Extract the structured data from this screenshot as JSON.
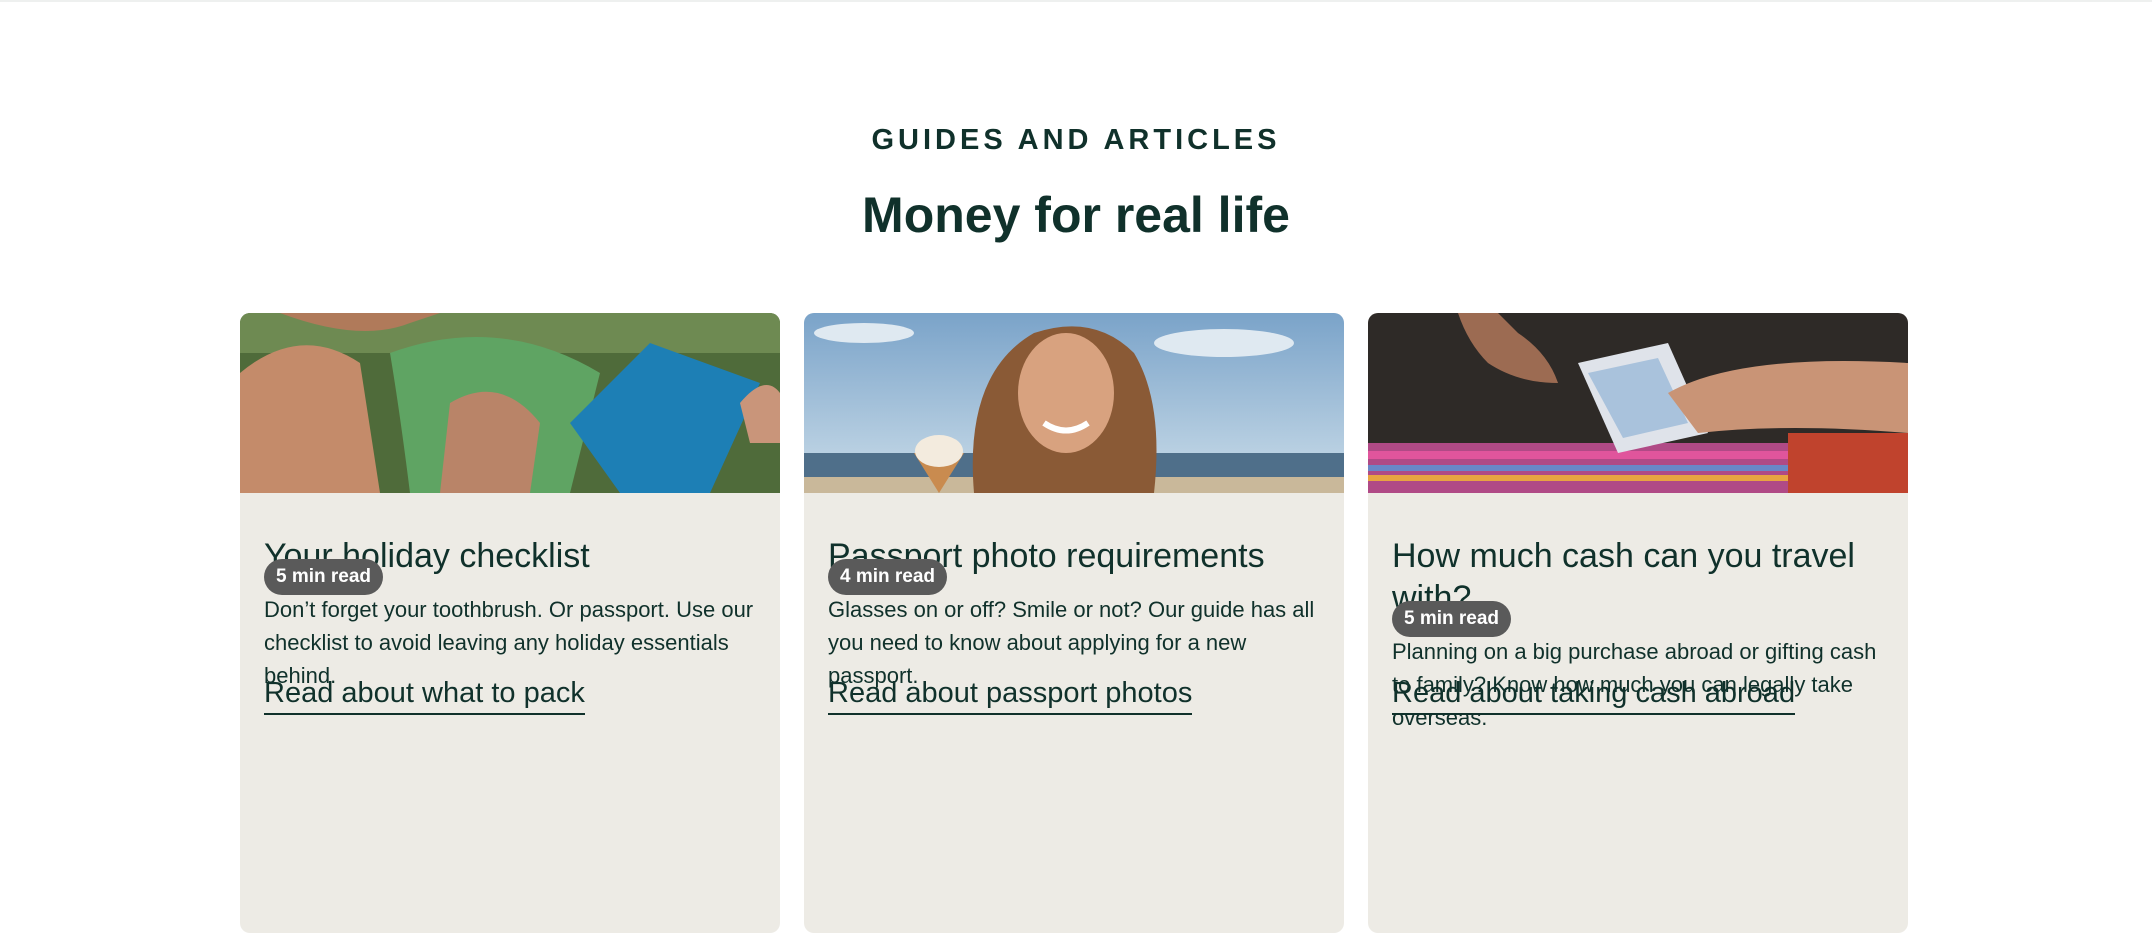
{
  "section": {
    "eyebrow": "GUIDES AND ARTICLES",
    "heading": "Money for real life"
  },
  "cards": [
    {
      "image_icon": "woman-reading-on-grass-image",
      "title": "Your holiday checklist",
      "description": "Don’t forget your toothbrush. Or passport. Use our checklist to avoid leaving any holiday essentials behind.",
      "read_time": "5 min read",
      "link": "Read about what to pack"
    },
    {
      "image_icon": "woman-with-ice-cream-on-beach-image",
      "title": "Passport photo requirements",
      "description": "Glasses on or off? Smile or not? Our guide has all you need to know about applying for a new passport.",
      "read_time": "4 min read",
      "link": "Read about passport photos"
    },
    {
      "image_icon": "hands-exchanging-cash-image",
      "title": "How much cash can you travel with?",
      "description": "Planning on a big purchase abroad or gifting cash to family? Know how much you can legally take overseas.",
      "read_time": "5 min read",
      "link": "Read about taking cash abroad"
    }
  ],
  "colors": {
    "text": "#10312b",
    "card_background": "#edebe5",
    "badge_background": "#5a5a5a"
  }
}
